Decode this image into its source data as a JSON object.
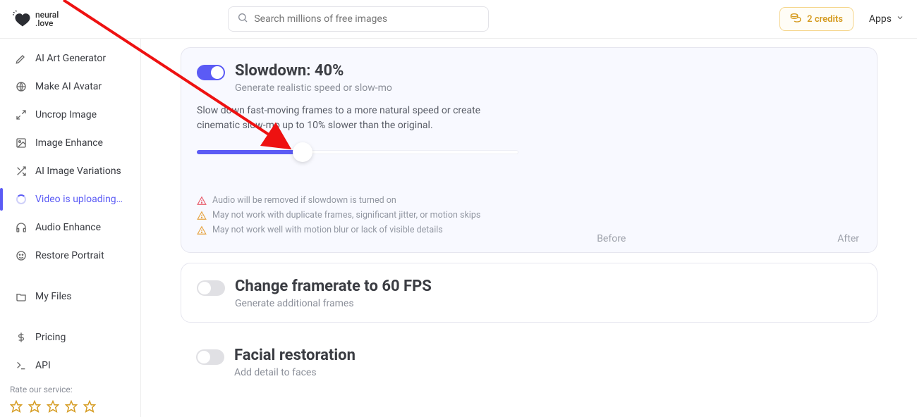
{
  "brand": {
    "line1": "neural",
    "line2": ".love"
  },
  "search": {
    "placeholder": "Search millions of free images"
  },
  "header": {
    "credits": "2 credits",
    "apps": "Apps"
  },
  "sidebar": {
    "items": [
      {
        "label": "AI Art Generator"
      },
      {
        "label": "Make AI Avatar"
      },
      {
        "label": "Uncrop Image"
      },
      {
        "label": "Image Enhance"
      },
      {
        "label": "AI Image Variations"
      },
      {
        "label": "Video is uploading…"
      },
      {
        "label": "Audio Enhance"
      },
      {
        "label": "Restore Portrait"
      }
    ],
    "myfiles": "My Files",
    "pricing": "Pricing",
    "api": "API",
    "rate_label": "Rate our service:"
  },
  "cards": {
    "slowdown": {
      "title": "Slowdown: 40%",
      "subtitle": "Generate realistic speed or slow-mo",
      "description": "Slow down fast-moving frames to a more natural speed or create cinematic slow-mo up to 10% slower than the original.",
      "slider_percent": 33,
      "warnings": [
        "Audio will be removed if slowdown is turned on",
        "May not work with duplicate frames, significant jitter, or motion skips",
        "May not work well with motion blur or lack of visible details"
      ],
      "before": "Before",
      "after": "After"
    },
    "framerate": {
      "title": "Change framerate to 60 FPS",
      "subtitle": "Generate additional frames"
    },
    "facial": {
      "title": "Facial restoration",
      "subtitle": "Add detail to faces"
    }
  },
  "chart_data": {
    "type": "bar",
    "title": "Slowdown slider",
    "categories": [
      "position_percent"
    ],
    "values": [
      33
    ],
    "xlabel": "",
    "ylabel": "",
    "ylim": [
      0,
      100
    ]
  }
}
